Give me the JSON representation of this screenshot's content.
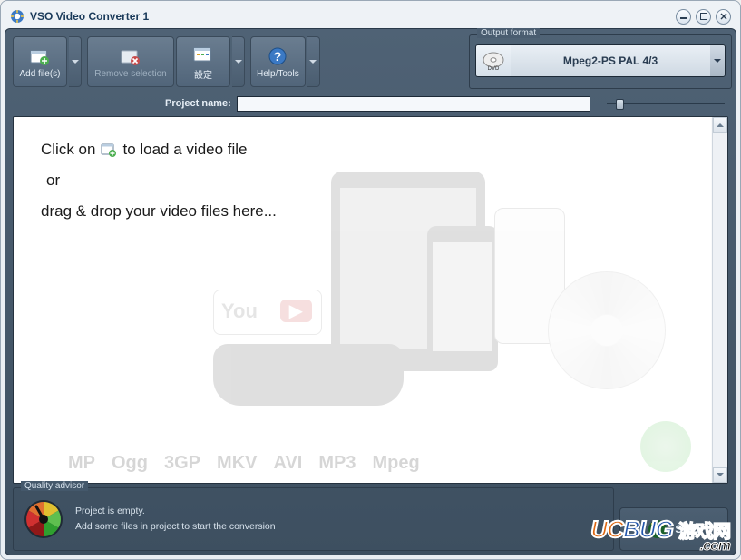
{
  "window": {
    "title": "VSO Video Converter 1"
  },
  "toolbar": {
    "add_label": "Add file(s)",
    "remove_label": "Remove selection",
    "settings_label": "設定",
    "help_label": "Help/Tools"
  },
  "output_format": {
    "legend": "Output format",
    "selected": "Mpeg2-PS PAL 4/3",
    "icon": "dvd-icon"
  },
  "project": {
    "name_label": "Project name:",
    "name_value": ""
  },
  "drop_area": {
    "line1_a": "Click on",
    "line1_b": "to load a video file",
    "line1_icon": "add-file-icon",
    "line2": "or",
    "line3": "drag & drop your video files here...",
    "ghost_formats": [
      "MP",
      "Ogg",
      "3GP",
      "MKV",
      "AVI",
      "MP3",
      "Mpeg"
    ]
  },
  "quality": {
    "legend": "Quality advisor",
    "line1": "Project is empty.",
    "line2": "Add some files in project to start the conversion"
  },
  "start": {
    "label": "Start"
  },
  "watermark": {
    "brand_a": "UC",
    "brand_b": "BUG",
    "cn": "游戏网",
    "dom": ".com"
  }
}
